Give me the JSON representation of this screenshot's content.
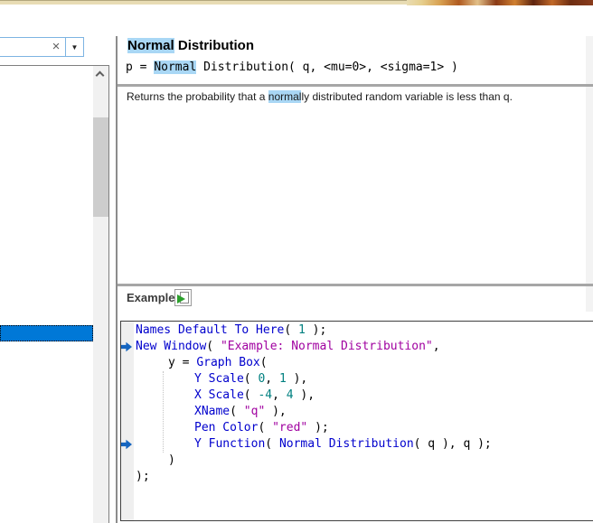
{
  "colors": {
    "highlight": "#a9d7f5",
    "selection": "#0078d7",
    "divider": "#a6a6a6",
    "searchbox_border": "#7db4e2",
    "marker": "#1565c0",
    "top_strip": "#e8dcb4",
    "keyword": "#0000cd",
    "number": "#008080",
    "string": "#a000a0",
    "plain": "#000000"
  },
  "sidebar": {
    "search": {
      "value": "",
      "placeholder": "",
      "clear_glyph": "×",
      "dropdown_glyph": "▼"
    },
    "list": {
      "items": [],
      "selected_item_label": ""
    }
  },
  "doc": {
    "title": {
      "pre": "",
      "highlight": "Normal",
      "post": " Distribution"
    },
    "signature": {
      "pre": "p = ",
      "highlight": "Normal",
      "post": " Distribution( q, <mu=0>, <sigma=1> )"
    },
    "description": {
      "pre": "Returns the probability that a ",
      "highlight": "normal",
      "post": "ly distributed random variable is less than q."
    }
  },
  "example": {
    "label": "Example",
    "run_button": "run-script",
    "code": {
      "lines": [
        {
          "indent": 0,
          "marker": false,
          "segments": [
            [
              "kw",
              "Names Default To Here"
            ],
            [
              "pl",
              "( "
            ],
            [
              "num",
              "1"
            ],
            [
              "pl",
              " );"
            ]
          ]
        },
        {
          "indent": 0,
          "marker": true,
          "segments": [
            [
              "kw",
              "New Window"
            ],
            [
              "pl",
              "( "
            ],
            [
              "str",
              "\"Example: Normal Distribution\""
            ],
            [
              "pl",
              ","
            ]
          ]
        },
        {
          "indent": 1,
          "marker": false,
          "segments": [
            [
              "pl",
              "y = "
            ],
            [
              "kw",
              "Graph Box"
            ],
            [
              "pl",
              "("
            ]
          ]
        },
        {
          "indent": 2,
          "marker": false,
          "segments": [
            [
              "kw",
              "Y Scale"
            ],
            [
              "pl",
              "( "
            ],
            [
              "num",
              "0"
            ],
            [
              "pl",
              ", "
            ],
            [
              "num",
              "1"
            ],
            [
              "pl",
              " ),"
            ]
          ]
        },
        {
          "indent": 2,
          "marker": false,
          "segments": [
            [
              "kw",
              "X Scale"
            ],
            [
              "pl",
              "( "
            ],
            [
              "num",
              "-4"
            ],
            [
              "pl",
              ", "
            ],
            [
              "num",
              "4"
            ],
            [
              "pl",
              " ),"
            ]
          ]
        },
        {
          "indent": 2,
          "marker": false,
          "segments": [
            [
              "kw",
              "XName"
            ],
            [
              "pl",
              "( "
            ],
            [
              "str",
              "\"q\""
            ],
            [
              "pl",
              " ),"
            ]
          ]
        },
        {
          "indent": 2,
          "marker": false,
          "segments": [
            [
              "kw",
              "Pen Color"
            ],
            [
              "pl",
              "( "
            ],
            [
              "str",
              "\"red\""
            ],
            [
              "pl",
              " );"
            ]
          ]
        },
        {
          "indent": 2,
          "marker": true,
          "segments": [
            [
              "kw",
              "Y Function"
            ],
            [
              "pl",
              "( "
            ],
            [
              "kw",
              "Normal Distribution"
            ],
            [
              "pl",
              "( q ), q );"
            ]
          ]
        },
        {
          "indent": 1,
          "marker": false,
          "segments": [
            [
              "pl",
              ")"
            ]
          ]
        },
        {
          "indent": 0,
          "marker": false,
          "segments": [
            [
              "pl",
              ");"
            ]
          ]
        }
      ]
    }
  }
}
